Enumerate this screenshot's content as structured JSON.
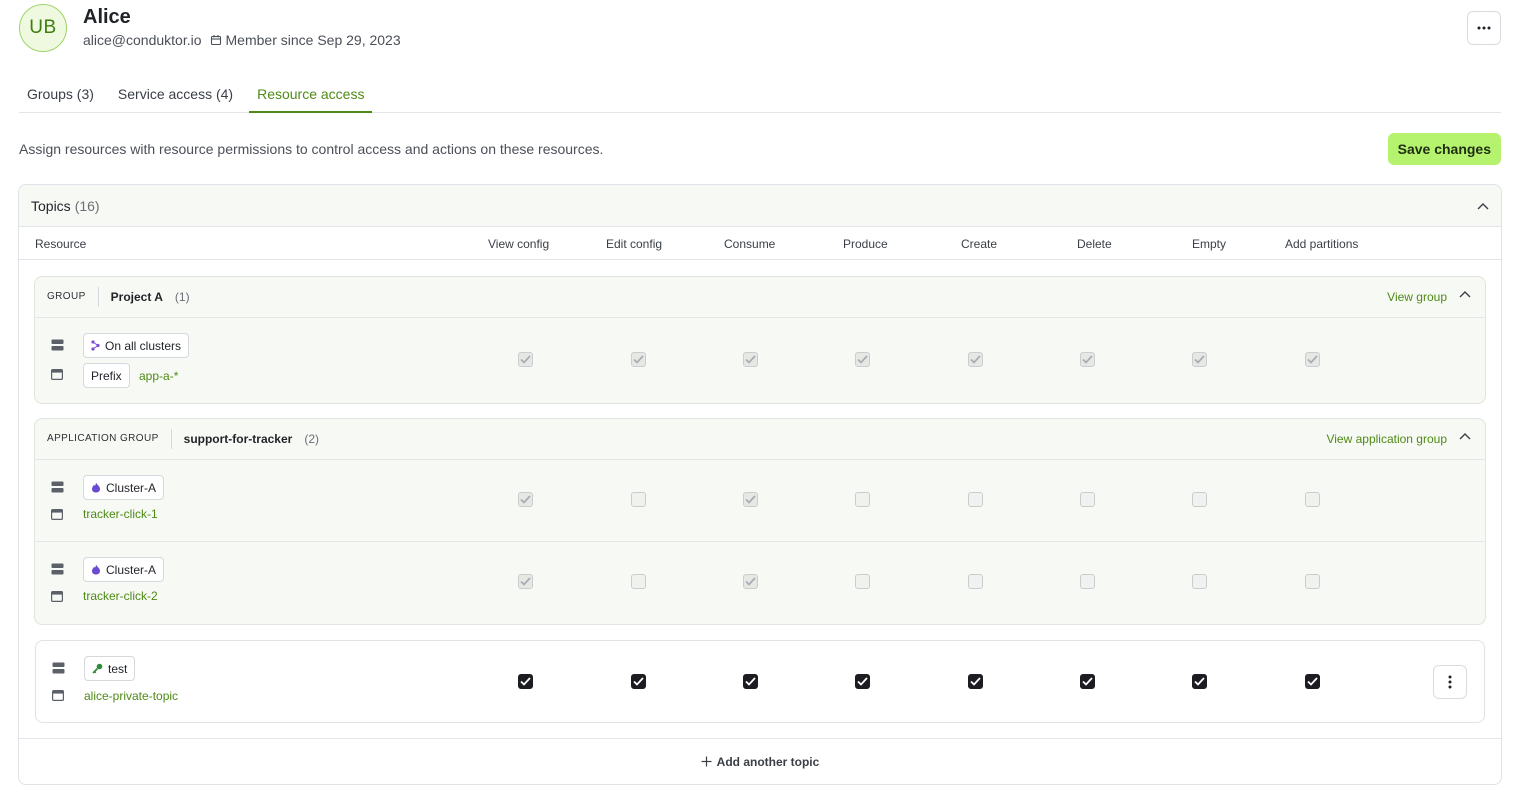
{
  "user": {
    "initials": "UB",
    "name": "Alice",
    "email": "alice@conduktor.io",
    "member_since": "Member since Sep 29, 2023"
  },
  "tabs": [
    {
      "label": "Groups (3)",
      "active": false
    },
    {
      "label": "Service access (4)",
      "active": false
    },
    {
      "label": "Resource access",
      "active": true
    }
  ],
  "description": "Assign resources with resource permissions to control access and actions on these resources.",
  "save_label": "Save changes",
  "topics": {
    "label": "Topics",
    "count": "(16)",
    "columns": [
      "Resource",
      "View config",
      "Edit config",
      "Consume",
      "Produce",
      "Create",
      "Delete",
      "Empty",
      "Add partitions"
    ],
    "add_label": "Add another topic"
  },
  "groups": [
    {
      "type": "GROUP",
      "name": "Project A",
      "count": "(1)",
      "link": "View group",
      "rows": [
        {
          "cluster": "On all clusters",
          "pattern_type": "Prefix",
          "topic": "app-a-*",
          "perms": [
            true,
            true,
            true,
            true,
            true,
            true,
            true,
            true
          ]
        }
      ]
    },
    {
      "type": "APPLICATION GROUP",
      "name": "support-for-tracker",
      "count": "(2)",
      "link": "View application group",
      "rows": [
        {
          "cluster": "Cluster-A",
          "topic": "tracker-click-1",
          "perms": [
            true,
            false,
            true,
            false,
            false,
            false,
            false,
            false
          ]
        },
        {
          "cluster": "Cluster-A",
          "topic": "tracker-click-2",
          "perms": [
            true,
            false,
            true,
            false,
            false,
            false,
            false,
            false
          ]
        }
      ]
    }
  ],
  "own": {
    "cluster": "test",
    "topic": "alice-private-topic",
    "perms": [
      true,
      true,
      true,
      true,
      true,
      true,
      true,
      true
    ]
  },
  "colors": {
    "accent": "#4f8a17",
    "save_bg": "#b5f36e",
    "avatar_bg": "#eef9df"
  }
}
